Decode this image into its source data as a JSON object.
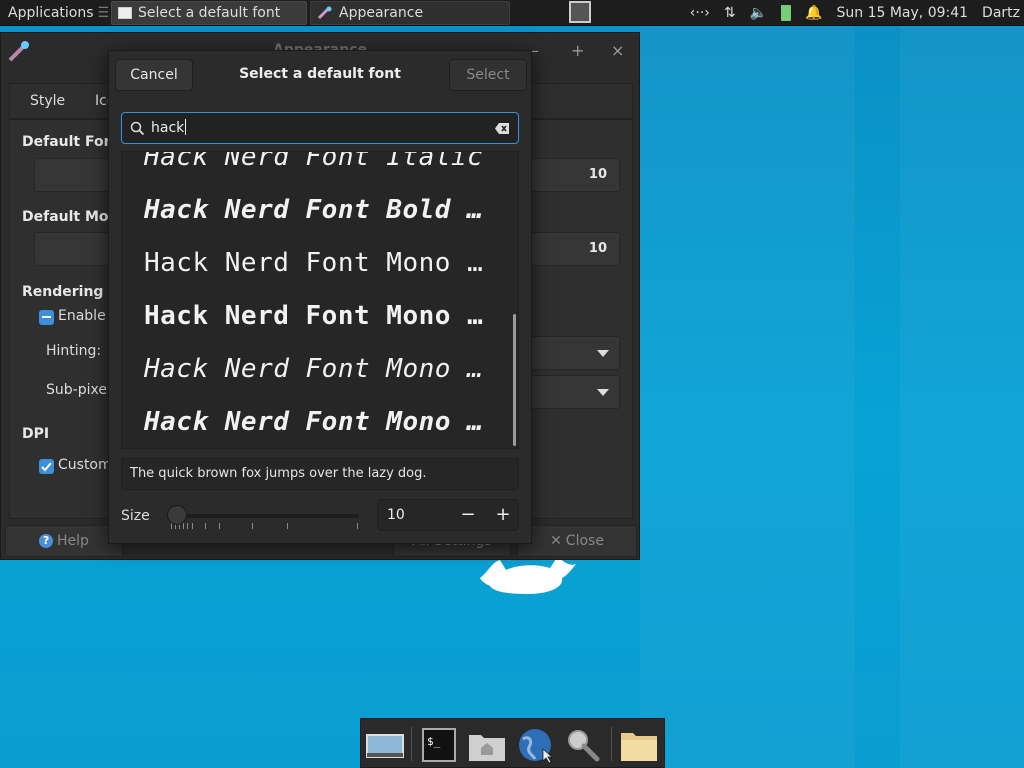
{
  "panel": {
    "apps_label": "Applications",
    "tasks": [
      {
        "label": "Select a default font"
      },
      {
        "label": "Appearance"
      }
    ],
    "clock": "Sun 15 May, 09:41",
    "user": "Dartz"
  },
  "appearance": {
    "title": "Appearance",
    "tabs": [
      "Style",
      "Icons"
    ],
    "default_font_heading": "Default Font",
    "default_font_size": "10",
    "default_mono_heading": "Default Monospace Font",
    "default_mono_size": "10",
    "rendering_heading": "Rendering",
    "antialias_label": "Enable anti-aliasing",
    "hinting_label": "Hinting:",
    "subpixel_label": "Sub-pixel order:",
    "dpi_heading": "DPI",
    "custom_dpi_label": "Custom DPI setting:",
    "help_label": "Help",
    "all_settings_label": "All Settings",
    "close_label": "Close"
  },
  "dialog": {
    "title": "Select a default font",
    "cancel_label": "Cancel",
    "select_label": "Select",
    "search_value": "hack",
    "fonts": [
      {
        "name": "Hack Nerd Font Italic",
        "weight": "normal",
        "style": "italic"
      },
      {
        "name": "Hack Nerd Font Bold Italic",
        "weight": "bold",
        "style": "italic"
      },
      {
        "name": "Hack Nerd Font Mono Regular",
        "weight": "normal",
        "style": "normal"
      },
      {
        "name": "Hack Nerd Font Mono Bold",
        "weight": "bold",
        "style": "normal"
      },
      {
        "name": "Hack Nerd Font Mono Italic",
        "weight": "normal",
        "style": "italic"
      },
      {
        "name": "Hack Nerd Font Mono Bold Italic",
        "weight": "bold",
        "style": "italic"
      }
    ],
    "preview_text": "The quick brown fox jumps over the lazy dog.",
    "size_label": "Size",
    "size_value": "10",
    "minus_label": "−",
    "plus_label": "+"
  },
  "colors": {
    "accent": "#3d8fd9",
    "desktop": "#0893c8",
    "panel": "#1d1d1d",
    "window": "#2b2b2b"
  }
}
